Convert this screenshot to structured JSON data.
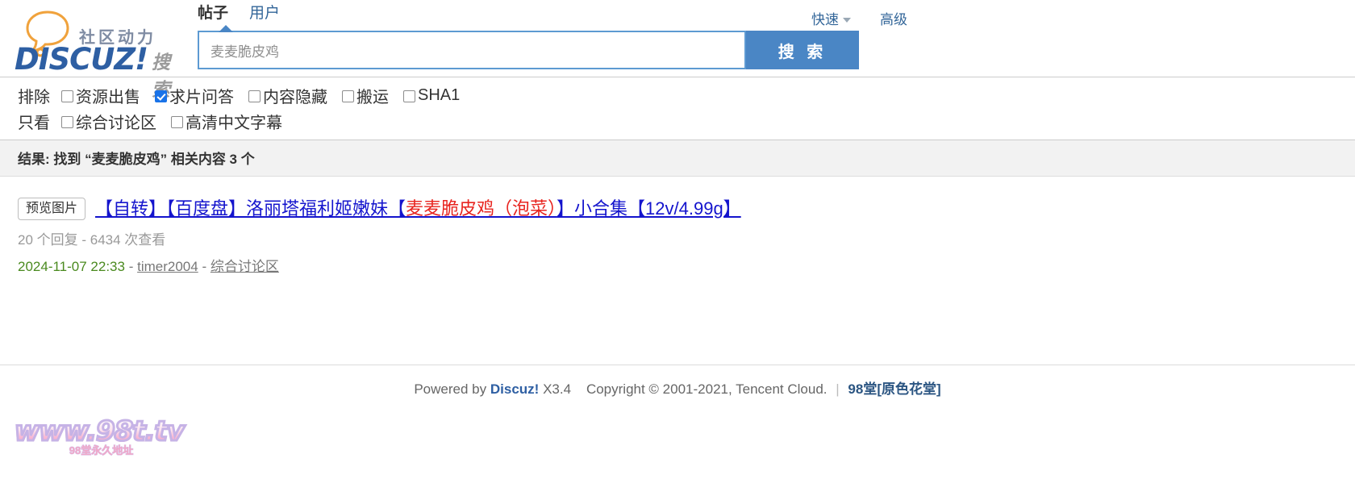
{
  "brand": {
    "slogan_cn": "社区动力",
    "name": "DISCUZ!",
    "suffix": "搜索"
  },
  "tabs": [
    {
      "label": "帖子",
      "active": true
    },
    {
      "label": "用户",
      "active": false
    }
  ],
  "header_links": [
    {
      "label": "快速",
      "has_caret": true
    },
    {
      "label": "高级",
      "has_caret": false
    }
  ],
  "search": {
    "value": "麦麦脆皮鸡",
    "placeholder": "麦麦脆皮鸡",
    "button_label": "搜 索"
  },
  "filters": {
    "exclude": {
      "label": "排除",
      "items": [
        {
          "label": "资源出售",
          "checked": false
        },
        {
          "label": "求片问答",
          "checked": true
        },
        {
          "label": "内容隐藏",
          "checked": false
        },
        {
          "label": "搬运",
          "checked": false
        },
        {
          "label": "SHA1",
          "checked": false
        }
      ]
    },
    "only": {
      "label": "只看",
      "items": [
        {
          "label": "综合讨论区",
          "checked": false
        },
        {
          "label": "高清中文字幕",
          "checked": false
        }
      ]
    }
  },
  "result_summary": "结果: 找到 “麦麦脆皮鸡” 相关内容 3 个",
  "results": [
    {
      "preview_label": "预览图片",
      "title_before": "【自转】【百度盘】洛丽塔福利姬嫩妹【",
      "title_hit": "麦麦脆皮鸡（泡菜）",
      "title_after": "】小合集【12v/4.99g】",
      "meta": "20 个回复 - 6434 次查看",
      "date": "2024-11-07 22:33",
      "author": "timer2004",
      "forum": "综合讨论区"
    }
  ],
  "footer": {
    "powered_prefix": "Powered by",
    "powered_brand": "Discuz!",
    "version": "X3.4",
    "copyright": "Copyright © 2001-2021, Tencent Cloud.",
    "site": "98堂[原色花堂]"
  },
  "watermark": {
    "text": "www.98t.tv",
    "sub": "98堂永久地址"
  },
  "colors": {
    "accent_blue": "#4a86c5",
    "link_blue": "#336699",
    "title_blue": "#1414cd",
    "highlight_red": "#e8241f",
    "date_green": "#4a8a1f",
    "checkbox_checked": "#1a73e8"
  }
}
